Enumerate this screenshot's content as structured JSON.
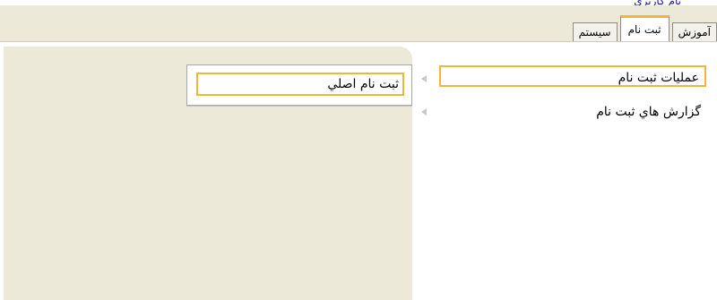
{
  "header": {
    "cut_text": "نام کاربري"
  },
  "tabs": [
    {
      "label": "آموزش",
      "active": false
    },
    {
      "label": "ثبت نام",
      "active": true
    },
    {
      "label": "سيستم",
      "active": false
    }
  ],
  "menu": {
    "items": [
      {
        "label": "عمليات ثبت نام"
      },
      {
        "label": "گزارش هاي ثبت نام"
      }
    ]
  },
  "submenu": {
    "items": [
      {
        "label": "ثبت نام اصلي"
      }
    ]
  },
  "colors": {
    "panel_bg": "#ece9d8",
    "accent": "#f2b43a"
  }
}
